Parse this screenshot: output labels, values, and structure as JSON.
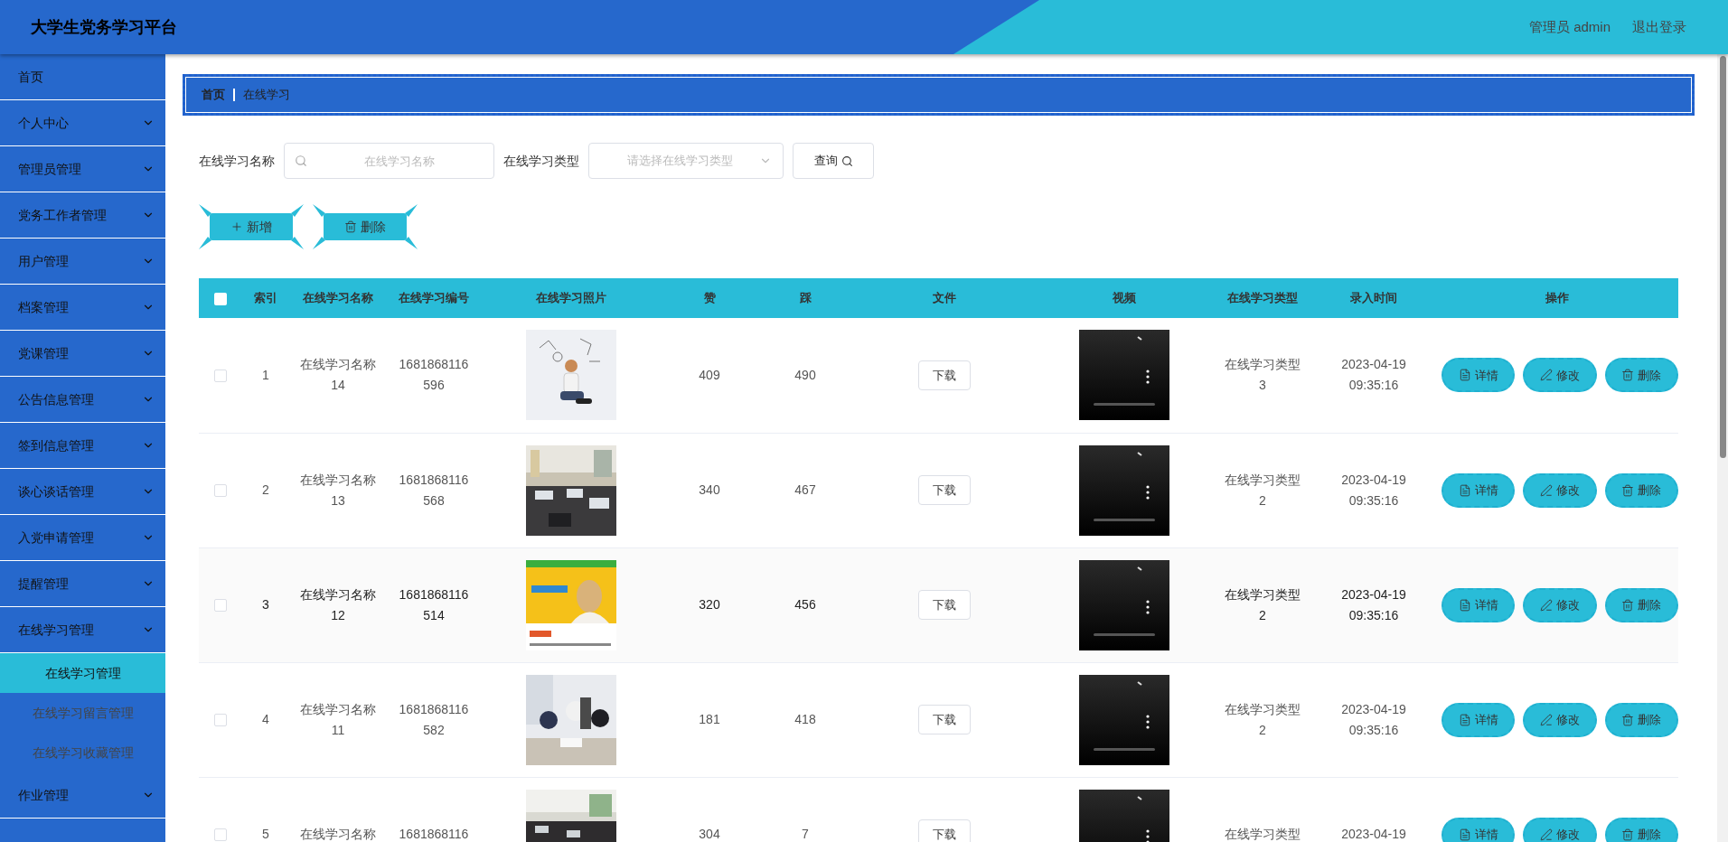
{
  "header": {
    "title": "大学生党务学习平台",
    "user": "管理员 admin",
    "logout": "退出登录"
  },
  "sidebar": {
    "items": [
      {
        "label": "首页",
        "kind": "link"
      },
      {
        "label": "个人中心",
        "kind": "menu",
        "expanded": false
      },
      {
        "label": "管理员管理",
        "kind": "menu",
        "expanded": false
      },
      {
        "label": "党务工作者管理",
        "kind": "menu",
        "expanded": false
      },
      {
        "label": "用户管理",
        "kind": "menu",
        "expanded": false
      },
      {
        "label": "档案管理",
        "kind": "menu",
        "expanded": false
      },
      {
        "label": "党课管理",
        "kind": "menu",
        "expanded": false
      },
      {
        "label": "公告信息管理",
        "kind": "menu",
        "expanded": false
      },
      {
        "label": "签到信息管理",
        "kind": "menu",
        "expanded": false
      },
      {
        "label": "谈心谈话管理",
        "kind": "menu",
        "expanded": false
      },
      {
        "label": "入党申请管理",
        "kind": "menu",
        "expanded": false
      },
      {
        "label": "提醒管理",
        "kind": "menu",
        "expanded": false
      },
      {
        "label": "在线学习管理",
        "kind": "menu",
        "children": [
          {
            "label": "在线学习管理",
            "selected": true
          },
          {
            "label": "在线学习留言管理",
            "selected": false
          },
          {
            "label": "在线学习收藏管理",
            "selected": false
          }
        ]
      },
      {
        "label": "作业管理",
        "kind": "menu",
        "expanded": false
      }
    ]
  },
  "breadcrumb": [
    "首页",
    "在线学习"
  ],
  "search": {
    "fields": [
      {
        "label": "在线学习名称",
        "placeholder": "在线学习名称",
        "kind": "text"
      },
      {
        "label": "在线学习类型",
        "placeholder": "请选择在线学习类型",
        "kind": "select"
      }
    ],
    "button": "查询"
  },
  "actions": [
    {
      "label": "新增",
      "kind": "add"
    },
    {
      "label": "删除",
      "kind": "delete"
    }
  ],
  "table": {
    "header_checked": false,
    "columns": [
      "索引",
      "在线学习名称",
      "在线学习编号",
      "在线学习照片",
      "赞",
      "踩",
      "文件",
      "视频",
      "在线学习类型",
      "录入时间",
      "操作"
    ],
    "rows": [
      {
        "checked": false,
        "index": "1",
        "name": [
          "在线学习名称",
          "14"
        ],
        "code": [
          "1681868116",
          "596"
        ],
        "likes": "409",
        "dislikes": "490",
        "file": "下载",
        "type": [
          "在线学习类型",
          "3"
        ],
        "time": [
          "2023-04-19",
          "09:35:16"
        ],
        "actions": [
          "详情",
          "修改",
          "删除"
        ]
      },
      {
        "checked": false,
        "index": "2",
        "name": [
          "在线学习名称",
          "13"
        ],
        "code": [
          "1681868116",
          "568"
        ],
        "likes": "340",
        "dislikes": "467",
        "file": "下载",
        "type": [
          "在线学习类型",
          "2"
        ],
        "time": [
          "2023-04-19",
          "09:35:16"
        ],
        "actions": [
          "详情",
          "修改",
          "删除"
        ]
      },
      {
        "checked": false,
        "index": "3",
        "name": [
          "在线学习名称",
          "12"
        ],
        "code": [
          "1681868116",
          "514"
        ],
        "likes": "320",
        "dislikes": "456",
        "file": "下载",
        "type": [
          "在线学习类型",
          "2"
        ],
        "time": [
          "2023-04-19",
          "09:35:16"
        ],
        "actions": [
          "详情",
          "修改",
          "删除"
        ]
      },
      {
        "checked": false,
        "index": "4",
        "name": [
          "在线学习名称",
          "11"
        ],
        "code": [
          "1681868116",
          "582"
        ],
        "likes": "181",
        "dislikes": "418",
        "file": "下载",
        "type": [
          "在线学习类型",
          "2"
        ],
        "time": [
          "2023-04-19",
          "09:35:16"
        ],
        "actions": [
          "详情",
          "修改",
          "删除"
        ]
      },
      {
        "checked": false,
        "index": "5",
        "name": [
          "在线学习名称"
        ],
        "code": [
          "1681868116"
        ],
        "likes": "304",
        "dislikes": "7",
        "file": "下载",
        "type": [
          "在线学习类型"
        ],
        "time": [
          "2023-04-19"
        ],
        "actions": [
          "详情",
          "修改",
          "删除"
        ]
      }
    ]
  }
}
